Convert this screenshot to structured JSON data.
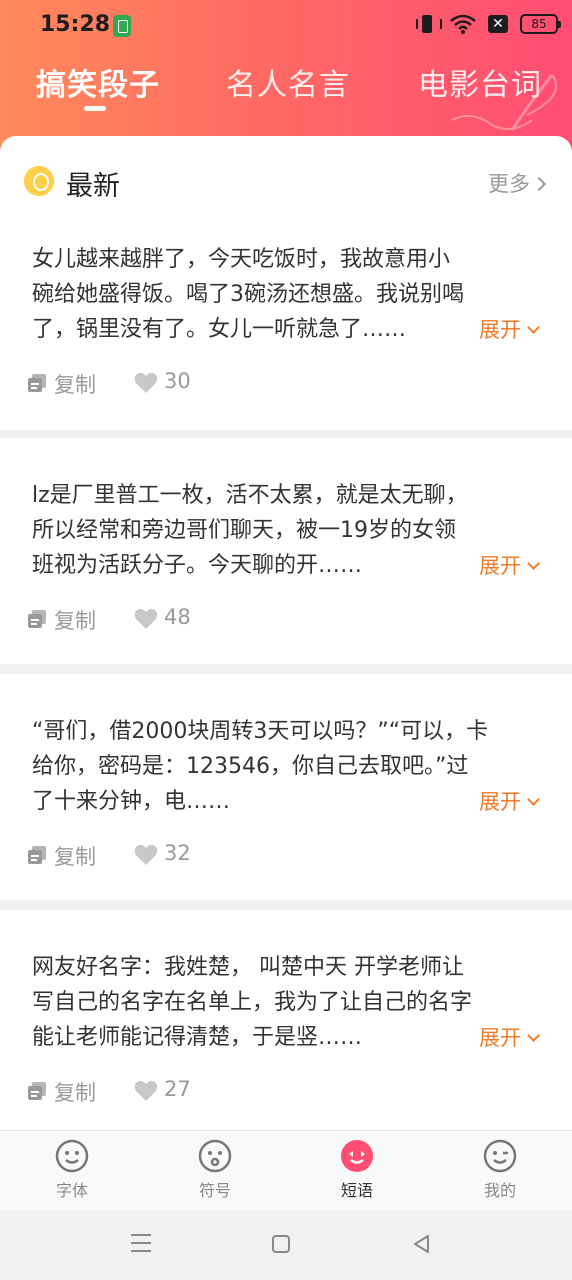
{
  "status_bar": {
    "time": "15:28",
    "battery_level": "85"
  },
  "tabs": [
    {
      "label": "搞笑段子",
      "active": true
    },
    {
      "label": "名人名言",
      "active": false
    },
    {
      "label": "电影台词",
      "active": false
    }
  ],
  "section": {
    "title": "最新",
    "more_label": "更多"
  },
  "jokes": [
    {
      "lines": [
        "女儿越来越胖了，今天吃饭时，我故意用小",
        "碗给她盛得饭。喝了3碗汤还想盛。我说别喝",
        "了，锅里没有了。女儿一听就急了……"
      ],
      "expand_label": "展开",
      "copy_label": "复制",
      "likes": "30"
    },
    {
      "lines": [
        "lz是厂里普工一枚，活不太累，就是太无聊，",
        "所以经常和旁边哥们聊天，被一19岁的女领",
        "班视为活跃分子。今天聊的开……"
      ],
      "expand_label": "展开",
      "copy_label": "复制",
      "likes": "48"
    },
    {
      "lines": [
        "“哥们，借2000块周转3天可以吗？”“可以，卡",
        "给你，密码是：123546，你自己去取吧。”过",
        "了十来分钟，电……"
      ],
      "expand_label": "展开",
      "copy_label": "复制",
      "likes": "32"
    },
    {
      "lines": [
        "网友好名字：我姓楚， 叫楚中天 开学老师让",
        "写自己的名字在名单上，我为了让自己的名字",
        "能让老师能记得清楚，于是竖……"
      ],
      "expand_label": "展开",
      "copy_label": "复制",
      "likes": "27"
    }
  ],
  "bottom_nav": [
    {
      "label": "字体",
      "icon": "face-icon",
      "active": false
    },
    {
      "label": "符号",
      "icon": "face-icon",
      "active": false
    },
    {
      "label": "短语",
      "icon": "face-icon",
      "active": true
    },
    {
      "label": "我的",
      "icon": "face-icon",
      "active": false
    }
  ],
  "colors": {
    "header_start": "#ff8a5c",
    "header_end": "#ff4d73",
    "accent_orange": "#f07a2a",
    "active_nav": "#ff4d73"
  }
}
